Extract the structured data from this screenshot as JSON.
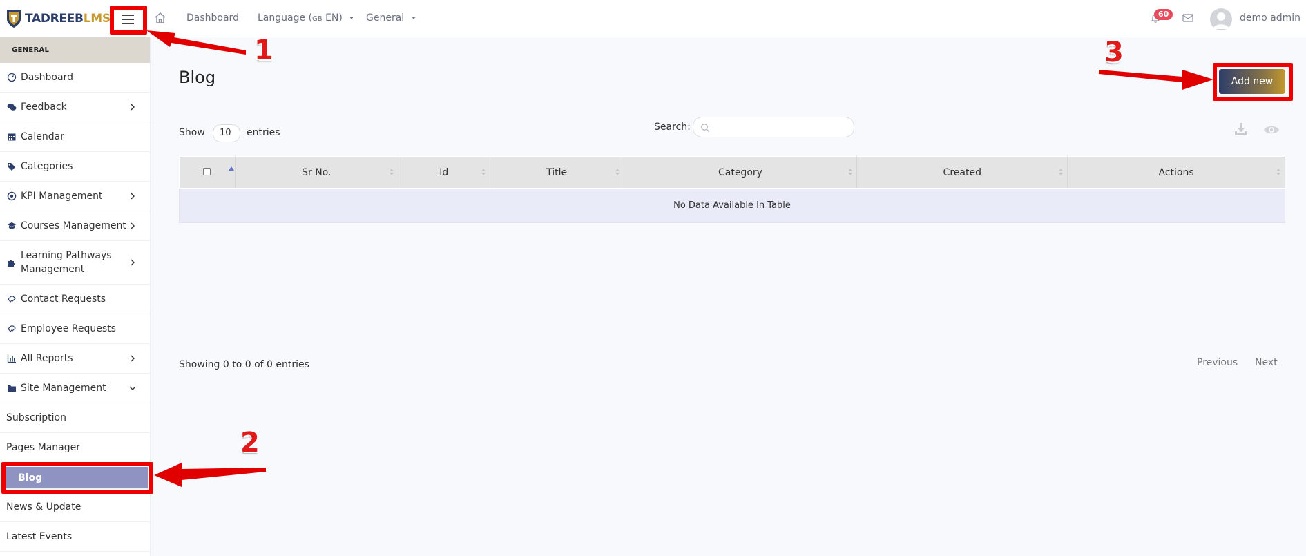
{
  "brand": {
    "part1": "TADREEB",
    "part2": "LMS"
  },
  "topbar": {
    "dashboard": "Dashboard",
    "language": "Language",
    "language_flag": "GB",
    "language_code": "EN",
    "general": "General",
    "notification_count": "60",
    "user_name": "demo admin"
  },
  "sidebar": {
    "section": "GENERAL",
    "items": [
      {
        "label": "Dashboard"
      },
      {
        "label": "Feedback"
      },
      {
        "label": "Calendar"
      },
      {
        "label": "Categories"
      },
      {
        "label": "KPI Management"
      },
      {
        "label": "Courses Management"
      },
      {
        "label": "Learning Pathways Management"
      },
      {
        "label": "Contact Requests"
      },
      {
        "label": "Employee Requests"
      },
      {
        "label": "All Reports"
      },
      {
        "label": "Site Management"
      },
      {
        "label": "Subscription"
      },
      {
        "label": "Pages Manager"
      },
      {
        "label": "Blog"
      },
      {
        "label": "News & Update"
      },
      {
        "label": "Latest Events"
      }
    ]
  },
  "main": {
    "title": "Blog",
    "add_button": "Add new",
    "show_label": "Show",
    "entries_value": "10",
    "entries_label": "entries",
    "search_label": "Search:",
    "search_value": "",
    "columns": [
      "Sr No.",
      "Id",
      "Title",
      "Category",
      "Created",
      "Actions"
    ],
    "empty_message": "No Data Available In Table",
    "showing_text": "Showing 0 to 0 of 0 entries",
    "prev": "Previous",
    "next": "Next"
  },
  "annotations": {
    "n1": "1",
    "n2": "2",
    "n3": "3",
    "color": "#e00000"
  }
}
